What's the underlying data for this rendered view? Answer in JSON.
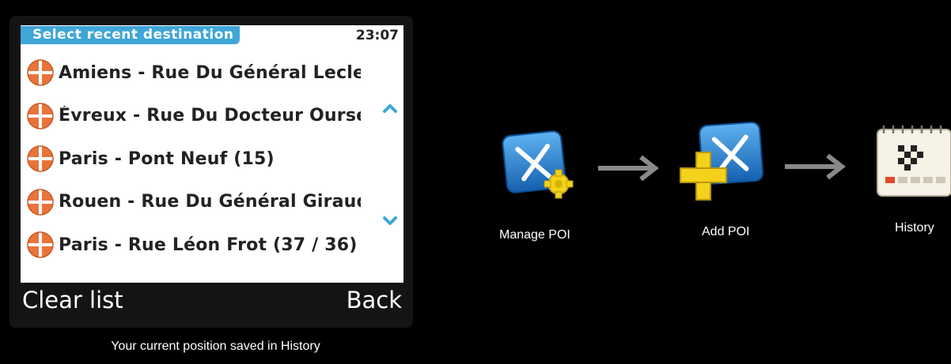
{
  "screen": {
    "title": "Select recent destination",
    "time": "23:07",
    "destinations": [
      {
        "label": "Amiens - Rue Du Général Lecle"
      },
      {
        "label": "Évreux - Rue Du Docteur Oursel"
      },
      {
        "label": "Paris - Pont Neuf (15)"
      },
      {
        "label": "Rouen - Rue Du Général Giraud"
      },
      {
        "label": "Paris - Rue Léon Frot (37 / 36)"
      }
    ],
    "softkeys": {
      "left": "Clear list",
      "right": "Back"
    }
  },
  "caption": "Your current position saved in History",
  "flow": {
    "steps": [
      {
        "label": "Manage POI",
        "icon": "manage-poi-icon"
      },
      {
        "label": "Add POI",
        "icon": "add-poi-icon"
      },
      {
        "label": "History",
        "icon": "history-icon"
      }
    ]
  },
  "colors": {
    "title_bar": "#3fa6d8",
    "pin_orange": "#e8743b",
    "icon_blue": "#1f7fd0",
    "plus_yellow": "#f2d21b",
    "arrow_gray": "#8a8a8a"
  }
}
